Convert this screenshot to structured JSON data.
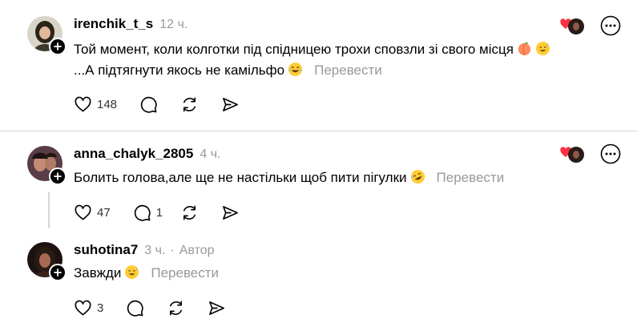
{
  "comments": [
    {
      "username": "irenchik_t_s",
      "time": "12 ч.",
      "text_line1": "Той момент, коли колготки під спідницею трохи сповзли зі свого місця",
      "text_line2": "...А підтягнути якось не камільфо",
      "emojis": [
        "peach-emoji",
        "smiling-sweat-emoji",
        "tears-of-joy-emoji"
      ],
      "translate_label": "Перевести",
      "likes": "148",
      "replies": "",
      "avatar_color": "#3a3a2a"
    },
    {
      "username": "anna_chalyk_2805",
      "time": "4 ч.",
      "text": "Болить голова,але ще не настільки щоб пити пігулки",
      "emojis": [
        "rofl-emoji"
      ],
      "translate_label": "Перевести",
      "likes": "47",
      "replies": "1",
      "avatar_color": "#4a2f3a"
    },
    {
      "username": "suhotina7",
      "time": "3 ч.",
      "author_label": "Автор",
      "text": "Завжди",
      "emojis": [
        "smiling-sweat-emoji"
      ],
      "translate_label": "Перевести",
      "likes": "3",
      "replies": "",
      "avatar_color": "#2a1a18"
    }
  ],
  "icons": {
    "like": "heart-icon",
    "reply": "comment-icon",
    "repost": "repost-icon",
    "share": "send-icon",
    "more": "more-icon"
  },
  "colors": {
    "muted_text": "#999999",
    "heart_red": "#ff3040",
    "divider": "#d9d9d9"
  }
}
